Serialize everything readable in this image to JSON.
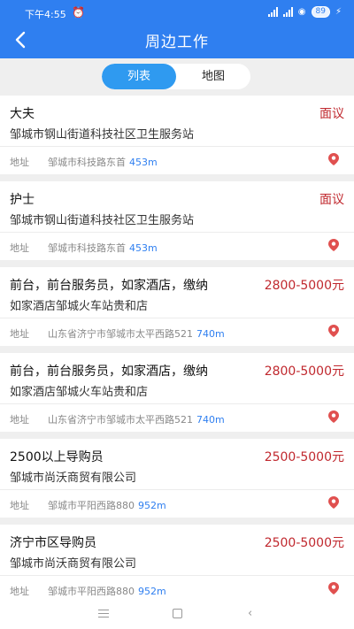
{
  "status": {
    "time": "下午4:55",
    "alarm_icon": "alarm-clock-icon",
    "battery": "89"
  },
  "header": {
    "title": "周边工作",
    "back_icon": "back-arrow-icon"
  },
  "tabs": [
    {
      "label": "列表",
      "active": true
    },
    {
      "label": "地图",
      "active": false
    }
  ],
  "address_label": "地址",
  "jobs": [
    {
      "title": "大夫",
      "salary": "面议",
      "company": "邹城市钢山街道科技社区卫生服务站",
      "address": "邹城市科技路东首",
      "distance": "453m"
    },
    {
      "title": "护士",
      "salary": "面议",
      "company": "邹城市钢山街道科技社区卫生服务站",
      "address": "邹城市科技路东首",
      "distance": "453m"
    },
    {
      "title": "前台，前台服务员，如家酒店，缴纳",
      "salary": "2800-5000元",
      "company": "如家酒店邹城火车站贵和店",
      "address": "山东省济宁市邹城市太平西路521",
      "distance": "740m"
    },
    {
      "title": "前台，前台服务员，如家酒店，缴纳",
      "salary": "2800-5000元",
      "company": "如家酒店邹城火车站贵和店",
      "address": "山东省济宁市邹城市太平西路521",
      "distance": "740m"
    },
    {
      "title": "2500以上导购员",
      "salary": "2500-5000元",
      "company": "邹城市尚沃商贸有限公司",
      "address": "邹城市平阳西路880",
      "distance": "952m"
    },
    {
      "title": "济宁市区导购员",
      "salary": "2500-5000元",
      "company": "邹城市尚沃商贸有限公司",
      "address": "邹城市平阳西路880",
      "distance": "952m"
    }
  ],
  "colors": {
    "primary": "#2f7ff0",
    "salary": "#c0282e",
    "tab_active": "#2f9af0",
    "pin": "#e0504f"
  }
}
